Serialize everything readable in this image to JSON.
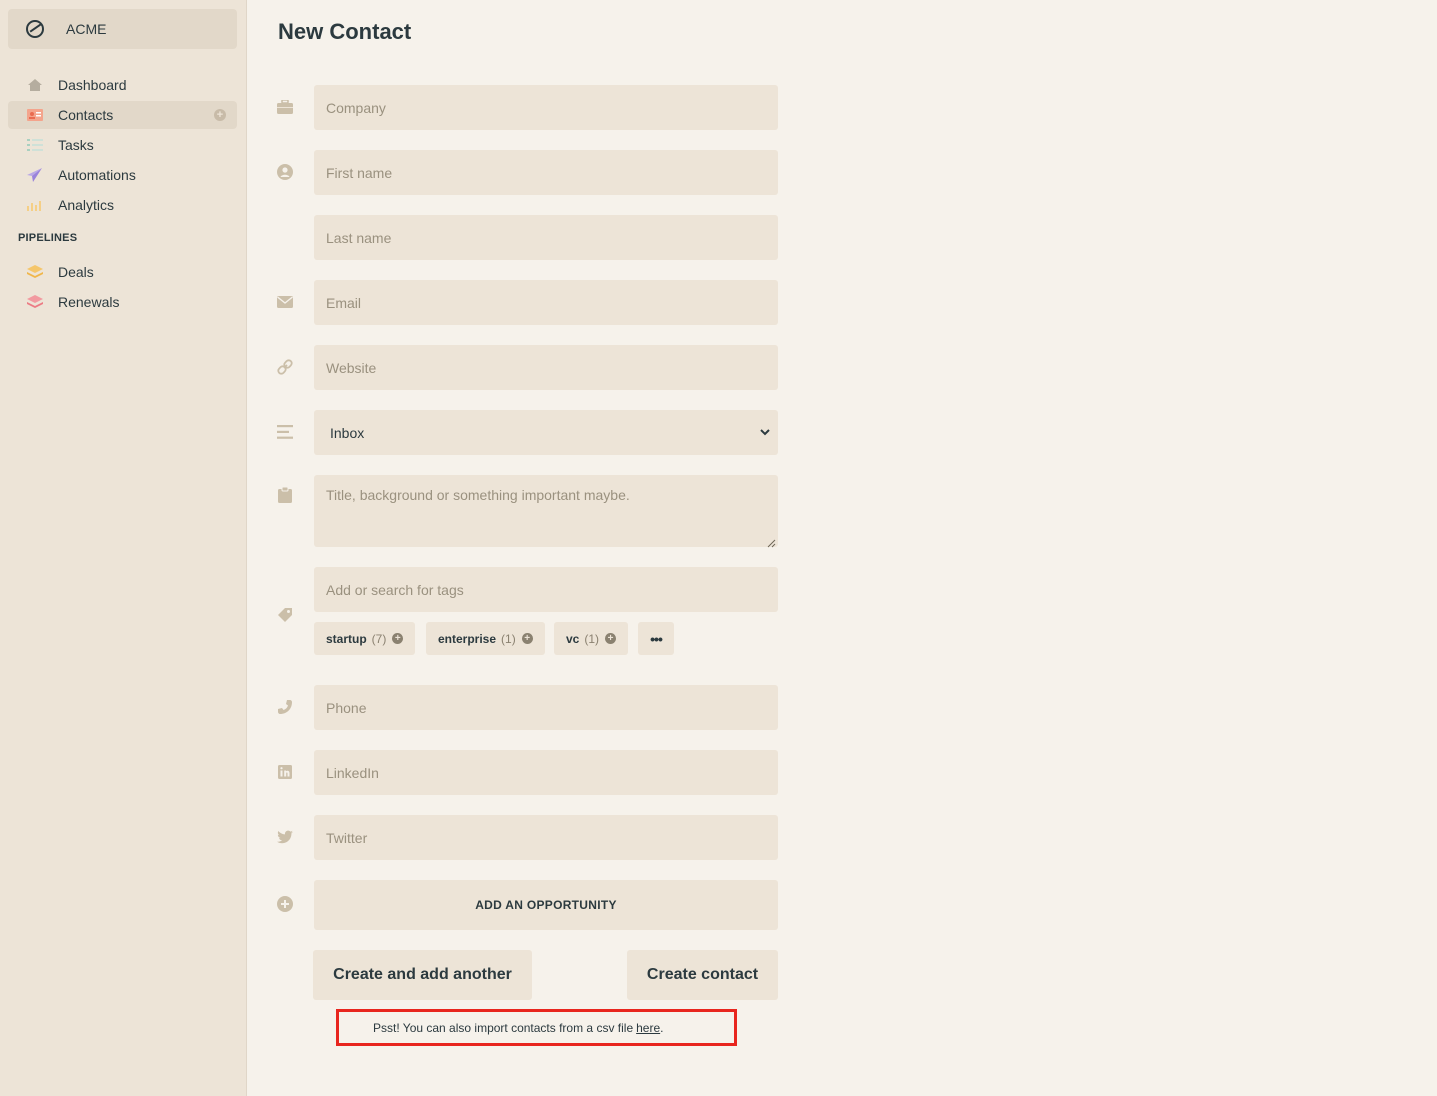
{
  "workspace": {
    "name": "ACME"
  },
  "nav": {
    "items": [
      {
        "label": "Dashboard",
        "icon": "home-icon"
      },
      {
        "label": "Contacts",
        "icon": "contact-card-icon",
        "active": true
      },
      {
        "label": "Tasks",
        "icon": "checklist-icon"
      },
      {
        "label": "Automations",
        "icon": "paper-plane-icon"
      },
      {
        "label": "Analytics",
        "icon": "bar-chart-icon"
      }
    ],
    "pipelines_title": "PIPELINES",
    "pipelines": [
      {
        "label": "Deals",
        "icon": "layers-icon"
      },
      {
        "label": "Renewals",
        "icon": "layers-icon"
      }
    ]
  },
  "page": {
    "title": "New Contact"
  },
  "form": {
    "company_placeholder": "Company",
    "first_name_placeholder": "First name",
    "last_name_placeholder": "Last name",
    "email_placeholder": "Email",
    "website_placeholder": "Website",
    "stage_value": "Inbox",
    "notes_placeholder": "Title, background or something important maybe.",
    "tags_placeholder": "Add or search for tags",
    "tags": [
      {
        "name": "startup",
        "count": "(7)"
      },
      {
        "name": "enterprise",
        "count": "(1)"
      },
      {
        "name": "vc",
        "count": "(1)"
      }
    ],
    "more_tags": "•••",
    "phone_placeholder": "Phone",
    "linkedin_placeholder": "LinkedIn",
    "twitter_placeholder": "Twitter",
    "add_opportunity": "ADD AN OPPORTUNITY",
    "create_and_add_another": "Create and add another",
    "create_contact": "Create contact"
  },
  "hint": {
    "text": "Psst! You can also import contacts from a csv file",
    "link": "here",
    "suffix": "."
  },
  "colors": {
    "sidebar_bg": "#ede4d7",
    "main_bg": "#f6f2eb",
    "field_bg": "#ede4d7",
    "text": "#2c3a3f",
    "highlight_border": "#e8261e"
  }
}
